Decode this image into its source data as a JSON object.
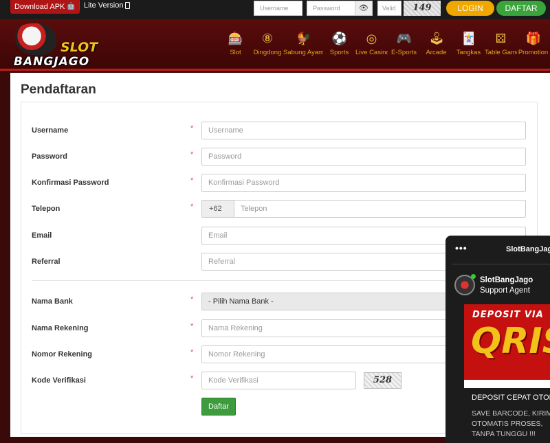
{
  "topbar": {
    "download_apk": "Download APK",
    "lite_version": "Lite Version",
    "username_placeholder": "Username",
    "password_placeholder": "Password",
    "valid_placeholder": "Valid",
    "captcha": "149",
    "login": "LOGIN",
    "daftar": "DAFTAR"
  },
  "logo": {
    "line1": "SLOT",
    "line2": "BANGJAGO"
  },
  "nav": [
    {
      "label": "Slot",
      "icon": "slot-machine-icon",
      "glyph": "🎰"
    },
    {
      "label": "Dingdong",
      "icon": "ball-8-icon",
      "glyph": "⑧"
    },
    {
      "label": "Sabung Ayam",
      "icon": "rooster-icon",
      "glyph": "🐓"
    },
    {
      "label": "Sports",
      "icon": "soccer-ball-icon",
      "glyph": "⚽"
    },
    {
      "label": "Live Casino",
      "icon": "roulette-icon",
      "glyph": "◎"
    },
    {
      "label": "E-Sports",
      "icon": "gamepad-icon",
      "glyph": "🎮"
    },
    {
      "label": "Arcade",
      "icon": "arcade-icon",
      "glyph": "🕹"
    },
    {
      "label": "Tangkas",
      "icon": "cards-icon",
      "glyph": "🃏"
    },
    {
      "label": "Table Games",
      "icon": "dice-icon",
      "glyph": "⚄"
    },
    {
      "label": "Promotion",
      "icon": "gift-icon",
      "glyph": "🎁"
    }
  ],
  "form": {
    "title": "Pendaftaran",
    "fields": {
      "username": {
        "label": "Username",
        "placeholder": "Username",
        "required": true
      },
      "password": {
        "label": "Password",
        "placeholder": "Password",
        "required": true
      },
      "konfirmasi": {
        "label": "Konfirmasi Password",
        "placeholder": "Konfirmasi Password",
        "required": true
      },
      "telepon": {
        "label": "Telepon",
        "prefix": "+62",
        "placeholder": "Telepon",
        "required": true
      },
      "email": {
        "label": "Email",
        "placeholder": "Email",
        "required": false
      },
      "referral": {
        "label": "Referral",
        "placeholder": "Referral",
        "required": false
      },
      "nama_bank": {
        "label": "Nama Bank",
        "selected": "- Pilih Nama Bank -",
        "required": true
      },
      "nama_rekening": {
        "label": "Nama Rekening",
        "placeholder": "Nama Rekening",
        "required": true
      },
      "nomor_rekening": {
        "label": "Nomor Rekening",
        "placeholder": "Nomor Rekening",
        "required": true
      },
      "kode_verifikasi": {
        "label": "Kode Verifikasi",
        "placeholder": "Kode Verifikasi",
        "required": true,
        "captcha": "528"
      }
    },
    "required_mark": "*",
    "submit": "Daftar"
  },
  "chat": {
    "menu_dots": "•••",
    "title": "SlotBangJago",
    "agent_name": "SlotBangJago",
    "agent_role": "Support Agent",
    "promo_top": "DEPOSIT VIA",
    "promo_big": "QRIS",
    "message_title": "DEPOSIT CEPAT OTOMATIS",
    "message_body": "SAVE BARCODE, KIRIM, OTOMATIS PROSES, TANPA TUNGGU !!!"
  },
  "colors": {
    "header_bg": "#4a0808",
    "accent_red": "#c41a1a",
    "login": "#f0a800",
    "daftar": "#3aa53a",
    "submit": "#3e9b3e",
    "nav_text": "#e6a21a"
  }
}
